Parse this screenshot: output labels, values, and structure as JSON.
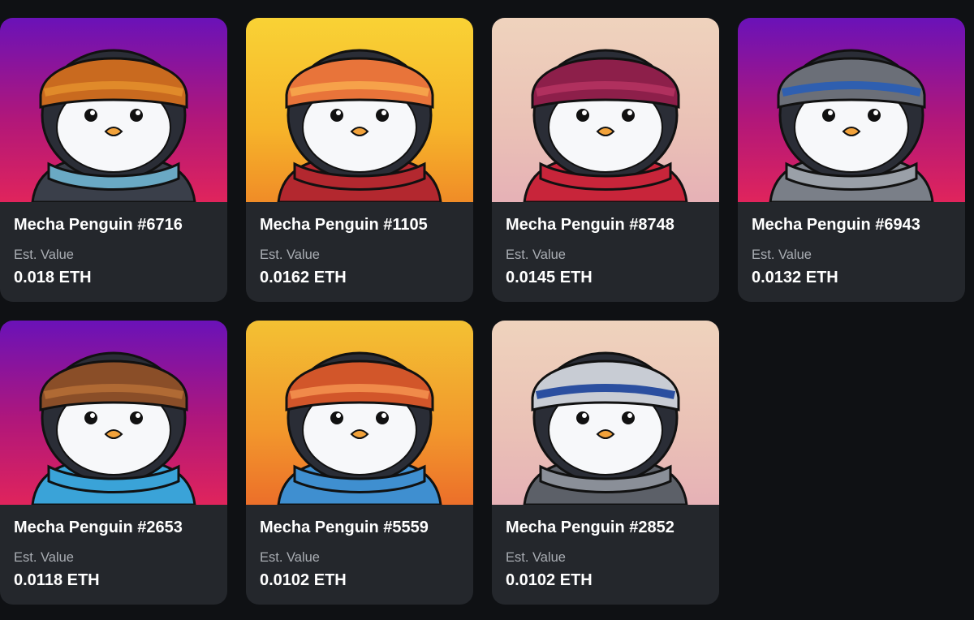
{
  "est_label": "Est. Value",
  "cards": [
    {
      "name": "Mecha Penguin #6716",
      "value": "0.018 ETH",
      "bg": "purple",
      "hat": "#c96a1f",
      "hat2": "#e08a2a",
      "scarf": "#6aa9c4",
      "body": "#3a3f4a"
    },
    {
      "name": "Mecha Penguin #1105",
      "value": "0.0162 ETH",
      "bg": "yellow",
      "hat": "#e8743a",
      "hat2": "#f6a24a",
      "scarf": "#b3282f",
      "body": "#b3282f"
    },
    {
      "name": "Mecha Penguin #8748",
      "value": "0.0145 ETH",
      "bg": "peach",
      "hat": "#8d1f4a",
      "hat2": "#b0305e",
      "scarf": "#c8253a",
      "body": "#c8253a"
    },
    {
      "name": "Mecha Penguin #6943",
      "value": "0.0132 ETH",
      "bg": "purple",
      "hat": "#6b6f78",
      "hat2": "#2f5fb0",
      "scarf": "#9aa0a8",
      "body": "#7a7f88"
    },
    {
      "name": "Mecha Penguin #2653",
      "value": "0.0118 ETH",
      "bg": "purple",
      "hat": "#8a4e28",
      "hat2": "#b06a34",
      "scarf": "#3aa3d8",
      "body": "#3aa3d8"
    },
    {
      "name": "Mecha Penguin #5559",
      "value": "0.0102 ETH",
      "bg": "orange",
      "hat": "#d2562a",
      "hat2": "#f08a4a",
      "scarf": "#3f8fd0",
      "body": "#3f8fd0"
    },
    {
      "name": "Mecha Penguin #2852",
      "value": "0.0102 ETH",
      "bg": "peach",
      "hat": "#c8ccd4",
      "hat2": "#2b4fa0",
      "scarf": "#8a8f98",
      "body": "#5c6068"
    }
  ]
}
